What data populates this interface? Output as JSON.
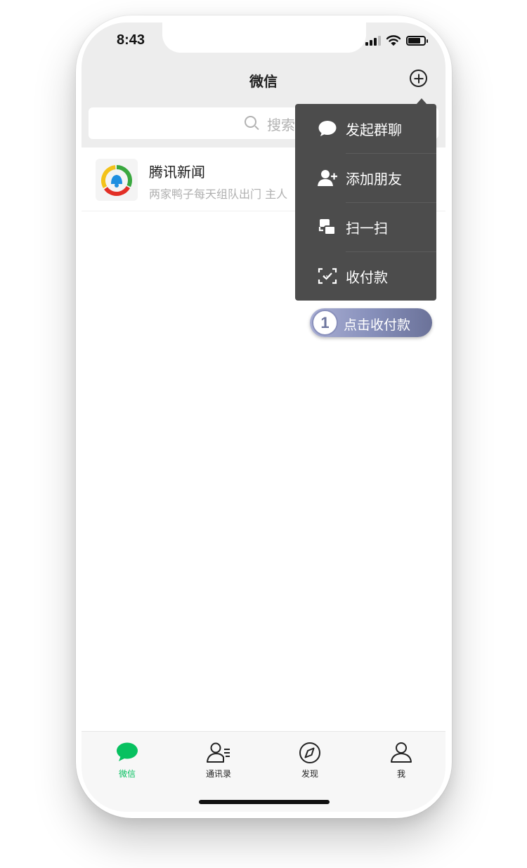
{
  "status_bar": {
    "time": "8:43"
  },
  "nav": {
    "title": "微信"
  },
  "search": {
    "placeholder": "搜索"
  },
  "chats": [
    {
      "name": "腾讯新闻",
      "preview": "两家鸭子每天组队出门 主人"
    }
  ],
  "popup_menu": [
    {
      "label": "发起群聊",
      "icon": "chat-bubble-icon"
    },
    {
      "label": "添加朋友",
      "icon": "add-friend-icon"
    },
    {
      "label": "扫一扫",
      "icon": "scan-icon"
    },
    {
      "label": "收付款",
      "icon": "payment-icon"
    }
  ],
  "hint": {
    "step": "1",
    "text": "点击收付款"
  },
  "tabs": [
    {
      "label": "微信",
      "icon": "chat-icon",
      "active": true
    },
    {
      "label": "通讯录",
      "icon": "contacts-icon",
      "active": false
    },
    {
      "label": "发现",
      "icon": "compass-icon",
      "active": false
    },
    {
      "label": "我",
      "icon": "me-icon",
      "active": false
    }
  ],
  "colors": {
    "accent_green": "#07c160",
    "popup_bg": "#4c4c4c",
    "header_bg": "#ededed",
    "hint_gradient_end": "#6b7299"
  }
}
